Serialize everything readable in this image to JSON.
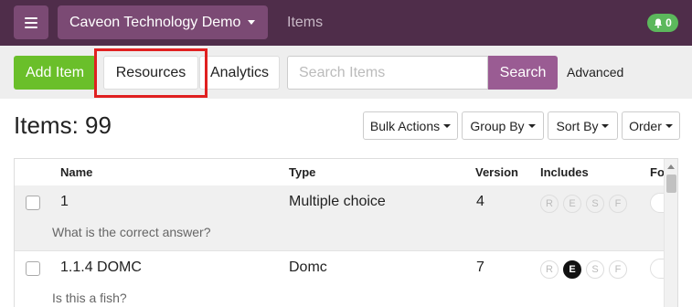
{
  "nav": {
    "org_label": "Caveon Technology Demo",
    "page_title": "Items",
    "notification_count": "0"
  },
  "toolbar": {
    "add_item": "Add Item",
    "resources": "Resources",
    "analytics": "Analytics",
    "search_placeholder": "Search Items",
    "search_button": "Search",
    "advanced": "Advanced"
  },
  "heading": {
    "items_count": "Items: 99",
    "bulk_actions": "Bulk Actions",
    "group_by": "Group By",
    "sort_by": "Sort By",
    "order": "Order"
  },
  "table": {
    "columns": [
      "Name",
      "Type",
      "Version",
      "Includes",
      "Fo"
    ],
    "rows": [
      {
        "name": "1",
        "type": "Multiple choice",
        "version": "4",
        "description": "What is the correct answer?",
        "includes": [
          "R",
          "E",
          "S",
          "F"
        ],
        "active": []
      },
      {
        "name": "1.1.4 DOMC",
        "type": "Domc",
        "version": "7",
        "description": "Is this a fish?",
        "includes": [
          "R",
          "E",
          "S",
          "F"
        ],
        "active": [
          "E"
        ]
      }
    ]
  },
  "colors": {
    "nav_bg": "#4f2d4a",
    "nav_button": "#7b4a74",
    "add_green": "#6abf2a",
    "search_purple": "#9a5c93",
    "notif_green": "#5cb85c",
    "highlight_red": "#e02020"
  },
  "icons": {
    "menu": "hamburger-icon",
    "notification": "bell-icon"
  }
}
